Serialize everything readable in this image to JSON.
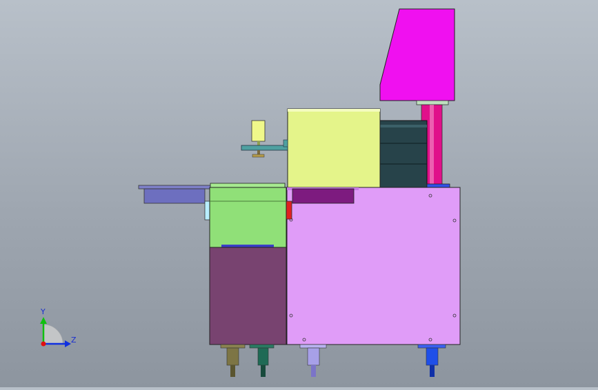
{
  "view": {
    "background": "#9ea6b0"
  },
  "triad": {
    "y_label": "Y",
    "z_label": "Z",
    "y_color": "#10c010",
    "z_color": "#1030e0",
    "x_color": "#e01010"
  },
  "parts": [
    {
      "name": "magenta-head",
      "color": "#f010f0"
    },
    {
      "name": "pink-column",
      "color": "#e0108a"
    },
    {
      "name": "lime-housing",
      "color": "#e4f48a"
    },
    {
      "name": "dark-teal-block",
      "color": "#27434a"
    },
    {
      "name": "main-cabinet",
      "color": "#e09cf8"
    },
    {
      "name": "green-upper-box",
      "color": "#90e078"
    },
    {
      "name": "plum-lower-box",
      "color": "#784370"
    },
    {
      "name": "slate-tray",
      "color": "#6d6fbf"
    },
    {
      "name": "yellow-indicator",
      "color": "#eff88a"
    },
    {
      "name": "teal-bracket",
      "color": "#4fa0a0"
    },
    {
      "name": "purple-strip",
      "color": "#7d1b7f"
    },
    {
      "name": "red-tab",
      "color": "#e02020"
    },
    {
      "name": "blue-base-plate",
      "color": "#3050e8"
    }
  ],
  "feet": [
    {
      "name": "olive-foot",
      "color": "#7d7545"
    },
    {
      "name": "green-foot",
      "color": "#1f6a55"
    },
    {
      "name": "lavender-foot",
      "color": "#a7a0e8"
    },
    {
      "name": "blue-foot",
      "color": "#1f4fe8"
    }
  ]
}
